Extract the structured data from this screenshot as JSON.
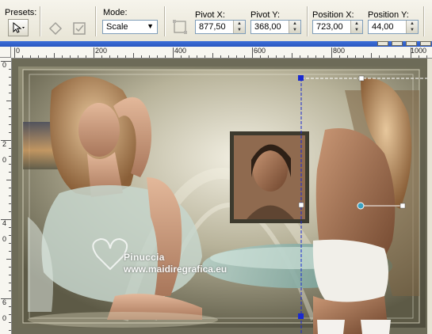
{
  "toolbar": {
    "presets_label": "Presets:",
    "mode_label": "Mode:",
    "mode_value": "Scale",
    "pivot_x_label": "Pivot X:",
    "pivot_x_value": "877,50",
    "pivot_y_label": "Pivot Y:",
    "pivot_y_value": "368,00",
    "position_x_label": "Position X:",
    "position_x_value": "723,00",
    "position_y_label": "Position Y:",
    "position_y_value": "44,00"
  },
  "ruler": {
    "top_labels": [
      "0",
      "200",
      "400",
      "600",
      "800",
      "1000"
    ],
    "left_labels": [
      "0",
      "2",
      "0",
      "4",
      "0",
      "6",
      "0"
    ]
  },
  "canvas": {
    "watermark_line1": "Pinuccia",
    "watermark_line2": "www.maidiregrafica.eu"
  },
  "colors": {
    "selection_handle": "#1a2ad0",
    "title_bar": "#2a57c0",
    "frame": "#6d6a54"
  }
}
